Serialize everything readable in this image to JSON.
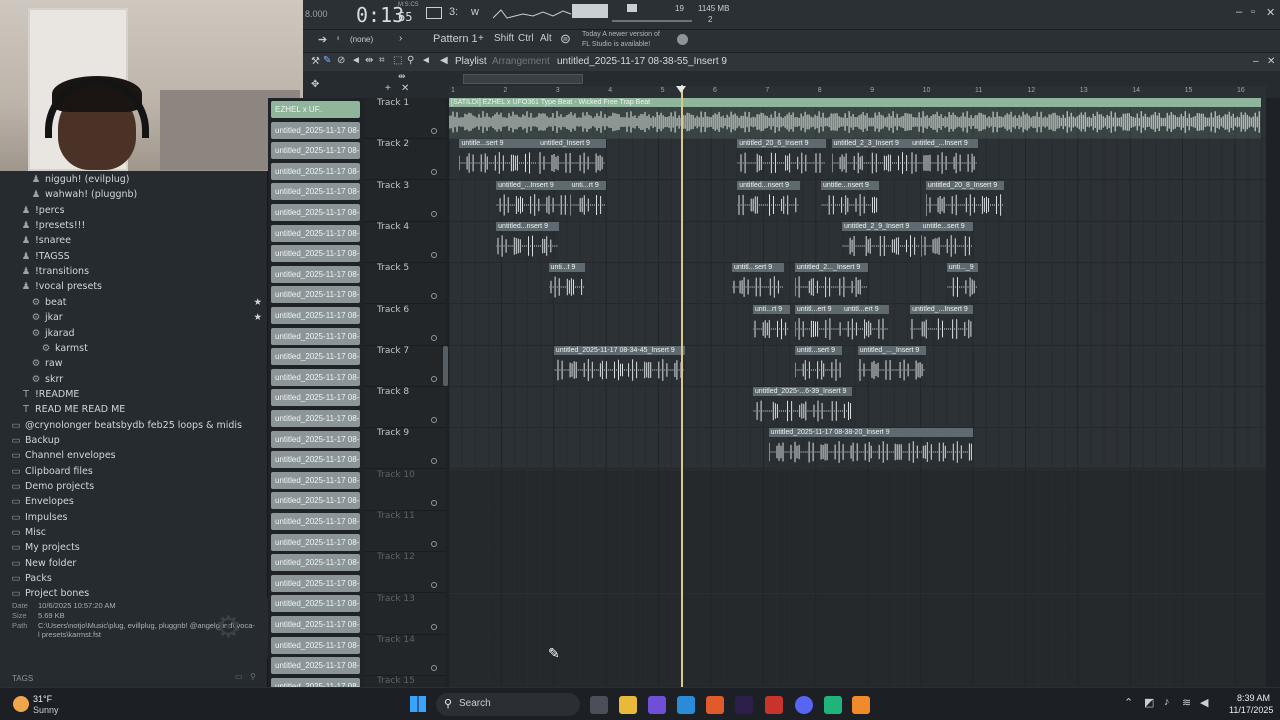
{
  "transport": {
    "time": "0:13",
    "time_small": "65",
    "tempo_left": "8.000",
    "mics": "M:S:CS",
    "pattern_num": "19",
    "cpu_mem": "1145 MB",
    "poly": "2"
  },
  "toolbar": {
    "none_label": "(none)",
    "pattern": "Pattern 1",
    "shift": "Shift",
    "ctrl": "Ctrl",
    "alt": "Alt",
    "news_line1": "Today  A newer version of",
    "news_line2": "FL Studio is available!"
  },
  "playlist": {
    "title": "Playlist",
    "sub": "Arrangement",
    "file": "untitled_2025-11-17 08-38-55_Insert 9"
  },
  "browser": {
    "items": [
      {
        "label": "nigguh! (evilplug)",
        "icon": "person-icon",
        "indent": 2
      },
      {
        "label": "wahwah! (pluggnb)",
        "icon": "person-icon",
        "indent": 2
      },
      {
        "label": "!percs",
        "icon": "person-icon",
        "indent": 1
      },
      {
        "label": "!presets!!!",
        "icon": "person-icon",
        "indent": 1
      },
      {
        "label": "!snaree",
        "icon": "person-icon",
        "indent": 1
      },
      {
        "label": "!TAGSS",
        "icon": "person-icon",
        "indent": 1
      },
      {
        "label": "!transitions",
        "icon": "person-icon",
        "indent": 1
      },
      {
        "label": "!vocal presets",
        "icon": "person-icon",
        "indent": 1
      },
      {
        "label": "beat",
        "icon": "gear-icon",
        "indent": 2,
        "star": true
      },
      {
        "label": "jkar",
        "icon": "gear-icon",
        "indent": 2,
        "star": true
      },
      {
        "label": "jkarad",
        "icon": "gear-icon",
        "indent": 2
      },
      {
        "label": "karmst",
        "icon": "gear-icon",
        "indent": 3
      },
      {
        "label": "raw",
        "icon": "gear-icon",
        "indent": 2
      },
      {
        "label": "skrr",
        "icon": "gear-icon",
        "indent": 2
      },
      {
        "label": "!README",
        "icon": "text-icon",
        "indent": 1
      },
      {
        "label": "READ ME READ ME",
        "icon": "text-icon",
        "indent": 1
      },
      {
        "label": "@crynolonger beatsbydb feb25 loops & midis",
        "icon": "folder-icon",
        "indent": 0
      },
      {
        "label": "Backup",
        "icon": "folder-icon",
        "indent": 0
      },
      {
        "label": "Channel envelopes",
        "icon": "folder-icon",
        "indent": 0
      },
      {
        "label": "Clipboard files",
        "icon": "folder-icon",
        "indent": 0
      },
      {
        "label": "Demo projects",
        "icon": "folder-icon",
        "indent": 0
      },
      {
        "label": "Envelopes",
        "icon": "folder-icon",
        "indent": 0
      },
      {
        "label": "Impulses",
        "icon": "folder-icon",
        "indent": 0
      },
      {
        "label": "Misc",
        "icon": "folder-icon",
        "indent": 0
      },
      {
        "label": "My projects",
        "icon": "folder-icon",
        "indent": 0
      },
      {
        "label": "New folder",
        "icon": "folder-icon",
        "indent": 0
      },
      {
        "label": "Packs",
        "icon": "folder-icon",
        "indent": 0
      },
      {
        "label": "Project bones",
        "icon": "folder-icon",
        "indent": 0
      }
    ],
    "info": {
      "date_k": "Date",
      "date_v": "10/6/2025 10:57:20 AM",
      "size_k": "Size",
      "size_v": "5.69 KB",
      "path_k": "Path",
      "path_v1": "C:\\Users\\notjo\\Music\\plug, evillplug, pluggnb! @angelgrind\\!voca-",
      "path_v2": "l presets\\karmst.fst"
    },
    "tags": "TAGS"
  },
  "channels": {
    "first": "EZHEL x UF..",
    "item": "untitled_2025-11-17 08-..."
  },
  "tracks": [
    "Track 1",
    "Track 2",
    "Track 3",
    "Track 4",
    "Track 5",
    "Track 6",
    "Track 7",
    "Track 8",
    "Track 9",
    "Track 10",
    "Track 11",
    "Track 12",
    "Track 13",
    "Track 14",
    "Track 15"
  ],
  "ruler": [
    "1",
    "2",
    "3",
    "4",
    "5",
    "6",
    "7",
    "8",
    "9",
    "10",
    "11",
    "12",
    "13",
    "14",
    "15",
    "16"
  ],
  "clips": [
    {
      "track": 0,
      "bar": 1.0,
      "len": 15.5,
      "label": "[SATILDI] EZHEL x UFO361 Type Beat - Wicked  Free Trap Beat",
      "main": true
    },
    {
      "track": 1,
      "bar": 1.2,
      "len": 1.5,
      "label": "untitle...sert 9"
    },
    {
      "track": 1,
      "bar": 2.7,
      "len": 1.3,
      "label": "untitled_Insert 9"
    },
    {
      "track": 1,
      "bar": 6.5,
      "len": 1.7,
      "label": "untitled_20_6_Insert 9"
    },
    {
      "track": 1,
      "bar": 8.3,
      "label": "untitled_2_3_Insert 9",
      "len": 1.5
    },
    {
      "track": 1,
      "bar": 9.8,
      "label": "untitled_...Insert 9",
      "len": 1.3
    },
    {
      "track": 2,
      "bar": 1.9,
      "len": 1.4,
      "label": "untitled_...Insert 9"
    },
    {
      "track": 2,
      "bar": 3.3,
      "len": 0.7,
      "label": "unti...rt 9"
    },
    {
      "track": 2,
      "bar": 6.5,
      "len": 1.2,
      "label": "untitled...nsert 9"
    },
    {
      "track": 2,
      "bar": 8.1,
      "len": 1.1,
      "label": "untitle...nsert 9"
    },
    {
      "track": 2,
      "bar": 10.1,
      "len": 1.5,
      "label": "untitled_20_8_Insert 9"
    },
    {
      "track": 3,
      "bar": 1.9,
      "len": 1.2,
      "label": "untitled...nsert 9"
    },
    {
      "track": 3,
      "bar": 8.5,
      "len": 1.5,
      "label": "untitled_2_9_Insert 9"
    },
    {
      "track": 3,
      "bar": 10.0,
      "len": 1.0,
      "label": "untitle...sert 9"
    },
    {
      "track": 4,
      "bar": 2.9,
      "len": 0.7,
      "label": "unti...t 9"
    },
    {
      "track": 4,
      "bar": 6.4,
      "len": 1.0,
      "label": "untitl...sert 9"
    },
    {
      "track": 4,
      "bar": 7.6,
      "len": 1.4,
      "label": "untitled_2..._Insert 9"
    },
    {
      "track": 4,
      "bar": 10.5,
      "len": 0.6,
      "label": "unti..._9"
    },
    {
      "track": 5,
      "bar": 6.8,
      "len": 0.7,
      "label": "unti...rt 9"
    },
    {
      "track": 5,
      "bar": 7.6,
      "len": 0.9,
      "label": "untitl...ert 9"
    },
    {
      "track": 5,
      "bar": 8.5,
      "len": 0.9,
      "label": "untitl...ert 9"
    },
    {
      "track": 5,
      "bar": 9.8,
      "len": 1.2,
      "label": "untitled_...Insert 9"
    },
    {
      "track": 6,
      "bar": 3.0,
      "len": 2.5,
      "label": "untitled_2025-11-17 08-34-45_Insert 9"
    },
    {
      "track": 6,
      "bar": 7.6,
      "len": 0.9,
      "label": "untitl...sert 9"
    },
    {
      "track": 6,
      "bar": 8.8,
      "len": 1.3,
      "label": "untitled_..._Insert 9"
    },
    {
      "track": 7,
      "bar": 6.8,
      "len": 1.9,
      "label": "untitled_2025-...6-39_Insert 9"
    },
    {
      "track": 8,
      "bar": 7.1,
      "len": 3.9,
      "label": "untitled_2025-11-17 08-38-20_Insert 9"
    }
  ],
  "taskbar": {
    "temp": "31°F",
    "weather": "Sunny",
    "search": "Search",
    "time": "8:39 AM",
    "date": "11/17/2025"
  },
  "colors": {
    "accent": "#8fb59a",
    "clip_title": "#5f6a70",
    "playhead": "#d9c98a"
  }
}
